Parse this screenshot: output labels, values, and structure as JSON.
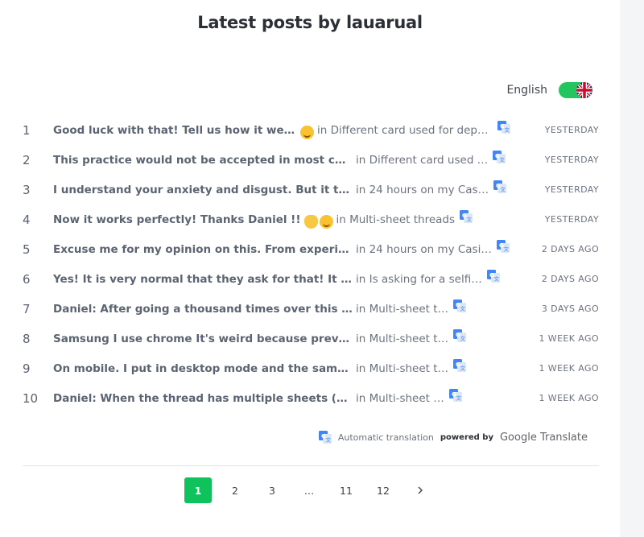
{
  "page": {
    "title": "Latest posts by lauarual"
  },
  "language": {
    "label": "English",
    "flag_icon": "uk-flag-icon",
    "toggle_on": true
  },
  "posts": [
    {
      "num": "1",
      "text": "Good luck with that! Tell us how it went!",
      "emoji": "smile",
      "in": "in Different card used for deposit",
      "when": "YESTERDAY"
    },
    {
      "num": "2",
      "text": "This practice would not be accepted in most casinos. It…",
      "emoji": "",
      "in": "in Different card used …",
      "when": "YESTERDAY"
    },
    {
      "num": "3",
      "text": "I understand your anxiety and disgust. But it turns ou…",
      "emoji": "",
      "in": "in 24 hours on my Cas…",
      "when": "YESTERDAY"
    },
    {
      "num": "4",
      "text": "Now it works perfectly! Thanks Daniel !!",
      "emoji": "wave-smile",
      "in": "in Multi-sheet threads",
      "when": "YESTERDAY"
    },
    {
      "num": "5",
      "text": "Excuse me for my opinion on this. From experience, I …",
      "emoji": "",
      "in": "in 24 hours on my Casi…",
      "when": "2 DAYS AGO"
    },
    {
      "num": "6",
      "text": "Yes! It is very normal that they ask for that! It is to veri…",
      "emoji": "",
      "in": "in Is asking for a selfi…",
      "when": "2 DAYS AGO"
    },
    {
      "num": "7",
      "text": "Daniel: After going a thousand times over this I realized the…",
      "emoji": "",
      "in": "in Multi-sheet t…",
      "when": "3 DAYS AGO"
    },
    {
      "num": "8",
      "text": "Samsung I use chrome It's weird because previously I could …",
      "emoji": "",
      "in": "in Multi-sheet t…",
      "when": "1 WEEK AGO"
    },
    {
      "num": "9",
      "text": "On mobile. I put in desktop mode and the same. I will have t…",
      "emoji": "",
      "in": "in Multi-sheet t…",
      "when": "1 WEEK AGO"
    },
    {
      "num": "10",
      "text": "Daniel: When the thread has multiple sheets (example: the p…",
      "emoji": "",
      "in": "in Multi-sheet …",
      "when": "1 WEEK AGO"
    }
  ],
  "credit": {
    "auto": "Automatic translation",
    "powered_by": "powered by",
    "google_translate": "Google Translate"
  },
  "pagination": {
    "pages": [
      "1",
      "2",
      "3",
      "…",
      "11",
      "12"
    ],
    "active": "1",
    "next_icon": "chevron-right-icon"
  },
  "colors": {
    "accent": "#0fc25b",
    "toggle": "#22c55e",
    "translate_icon": "#4285f4"
  }
}
